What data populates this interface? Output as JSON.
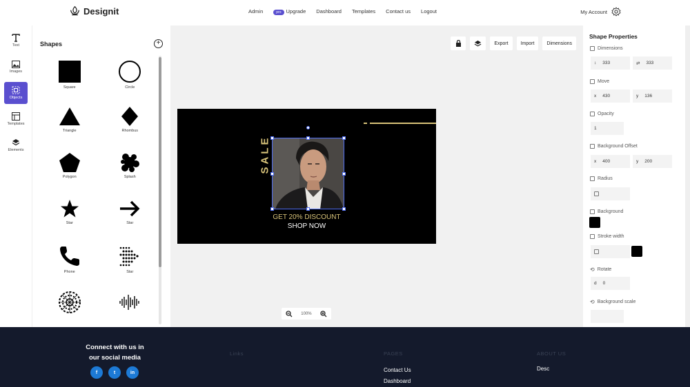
{
  "brand": {
    "name": "Designit"
  },
  "nav": {
    "admin": "Admin",
    "pro_badge": "pro",
    "upgrade": "Upgrade",
    "dashboard": "Dashboard",
    "templates": "Templates",
    "contact": "Contact us",
    "logout": "Logout",
    "account": "My Account"
  },
  "leftbar": {
    "items": [
      {
        "label": "Text",
        "icon": "text-icon"
      },
      {
        "label": "Images",
        "icon": "image-icon"
      },
      {
        "label": "Objects",
        "icon": "objects-icon",
        "active": true
      },
      {
        "label": "Templates",
        "icon": "templates-icon"
      },
      {
        "label": "Elements",
        "icon": "layers-icon"
      }
    ]
  },
  "shapes": {
    "title": "Shapes",
    "items": [
      {
        "label": "Square"
      },
      {
        "label": "Circle"
      },
      {
        "label": "Triangle"
      },
      {
        "label": "Rhombus"
      },
      {
        "label": "Polygon"
      },
      {
        "label": "Splash"
      },
      {
        "label": "Star"
      },
      {
        "label": "Star"
      },
      {
        "label": "Phone"
      },
      {
        "label": "Star"
      }
    ]
  },
  "toolbar": {
    "export": "Export",
    "import": "Import",
    "dimensions": "Dimensions"
  },
  "canvas": {
    "sale_text": "SALE",
    "discount_text": "GET 20% DISCOUNT",
    "shop_text": "SHOP NOW"
  },
  "zoom": {
    "level": "100%"
  },
  "properties": {
    "title": "Shape Properties",
    "dimensions_label": "Dimensions",
    "width": "333",
    "height": "333",
    "move_label": "Move",
    "x_label": "x",
    "y_label": "y",
    "move_x": "430",
    "move_y": "136",
    "opacity_label": "Opacity",
    "opacity": "1",
    "bg_offset_label": "Background Offset",
    "offset_x": "400",
    "offset_y": "200",
    "radius_label": "Radius",
    "background_label": "Background",
    "background_color": "#000000",
    "stroke_label": "Stroke width",
    "stroke_color": "#000000",
    "rotate_label": "Rotate",
    "rotate_prefix": "d",
    "rotate": "0",
    "bg_scale_label": "Background scale"
  },
  "footer": {
    "connect_line1": "Connect with us in",
    "connect_line2": "our social media",
    "links_head": "Links",
    "pages_head": "PAGES",
    "about_head": "ABOUT US",
    "pages_links": [
      "Contact Us",
      "Dashboard"
    ],
    "about_desc": "Desc",
    "social": [
      "f",
      "t",
      "in"
    ]
  }
}
